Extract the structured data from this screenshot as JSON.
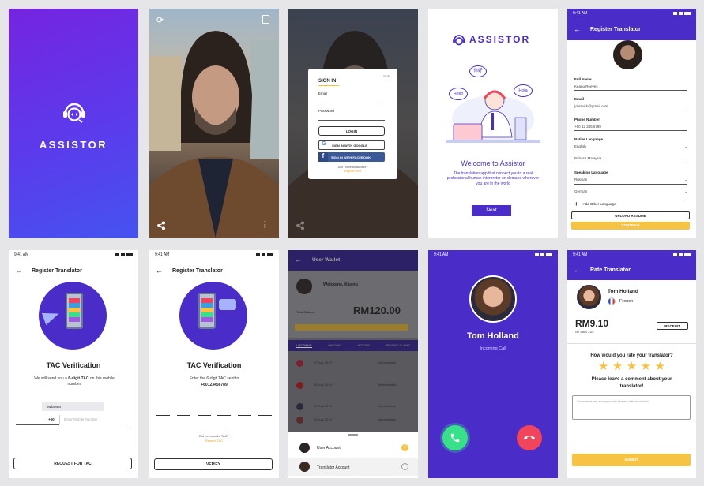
{
  "colors": {
    "purple": "#4a2dc9",
    "gradient_top": "#7524e0",
    "gradient_bottom": "#4a4ef0",
    "yellow": "#f6c344",
    "green": "#38e08a",
    "red": "#f0455a"
  },
  "splash": {
    "brand": "ASSISTOR"
  },
  "camera": {
    "refresh_icon": "refresh-icon",
    "share_icon": "share-icon",
    "menu_icon": "more-vert-icon"
  },
  "signin": {
    "title": "SIGN IN",
    "skip": "SKIP",
    "email_label": "Email",
    "password_label": "Password",
    "login": "LOGIN",
    "google": "SIGN IN WITH GOOGLE",
    "facebook": "SIGN IN WITH FACEBOOK",
    "no_account": "Don't have an account?",
    "register": "Register here"
  },
  "welcome": {
    "brand": "ASSISTOR",
    "bubble_left": "Hello",
    "bubble_top": "你好",
    "bubble_right": "Hola",
    "title": "Welcome to Assistor",
    "desc": "The translation app that connect you to a real professional human interpreter on demand wherever you are in the world",
    "next": "Next"
  },
  "register": {
    "time": "9:41 AM",
    "title": "Register Translator",
    "full_name_label": "Full Name",
    "full_name": "Keanu Reeves",
    "email_label": "Email",
    "email": "johnwick@gmail.com",
    "phone_label": "Phone Number",
    "phone": "+60 12 345 6789",
    "native_label": "Native Language",
    "native_1": "English",
    "native_2": "Bahasa Malaysia",
    "speaking_label": "Speaking Language",
    "speaking_1": "Russian",
    "speaking_2": "German",
    "add_other": "Add Other Language",
    "upload": "UPLOAD RESUME",
    "continue": "CONTINUE"
  },
  "tac1": {
    "time": "9:41 AM",
    "title": "Register Translator",
    "heading": "TAC Verification",
    "desc_pre": "We will send you a ",
    "desc_bold": "6-digit TAC",
    "desc_post": " on this mobile number",
    "country": "Malaysia",
    "code": "+60",
    "placeholder": "Enter Mobile Number",
    "request": "REQUEST FOR TAC"
  },
  "tac2": {
    "time": "9:41 AM",
    "title": "Register Translator",
    "heading": "TAC Verification",
    "desc": "Enter the 6-digit TAC sent to",
    "phone": "+60123456789",
    "not_received": "Did not receive TAC?",
    "resend": "Resend TAC",
    "verify": "VERIFY"
  },
  "wallet": {
    "title": "User Wallet",
    "welcome": "Welcome, Keanu",
    "balance_label": "Total Balance",
    "balance": "RM120.00",
    "tabs": [
      "UPCOMING",
      "ONGOING",
      "HISTORY",
      "PENDING CLAIMS"
    ],
    "rows": [
      {
        "date": "27 July 2019",
        "more": "More details"
      },
      {
        "date": "28 July 2019",
        "more": "More details"
      },
      {
        "date": "29 July 2019",
        "more": "More details"
      },
      {
        "date": "30 July 2019",
        "more": "More details"
      }
    ],
    "user_account": "User Account",
    "translator_account": "Translator Account"
  },
  "call": {
    "time": "9:41 AM",
    "name": "Tom Holland",
    "status": "Incoming Call"
  },
  "rate": {
    "time": "9:41 AM",
    "title": "Rate Translator",
    "name": "Tom Holland",
    "language": "French",
    "amount": "RM9.10",
    "duration": "0h 45m 22s",
    "receipt": "RECEIPT",
    "question": "How would you rate your translator?",
    "stars": 5,
    "comment_prompt": "Please leave a comment about your translator!",
    "comment_placeholder": "Comments are anonymously shared with translators",
    "submit": "SUBMIT"
  }
}
